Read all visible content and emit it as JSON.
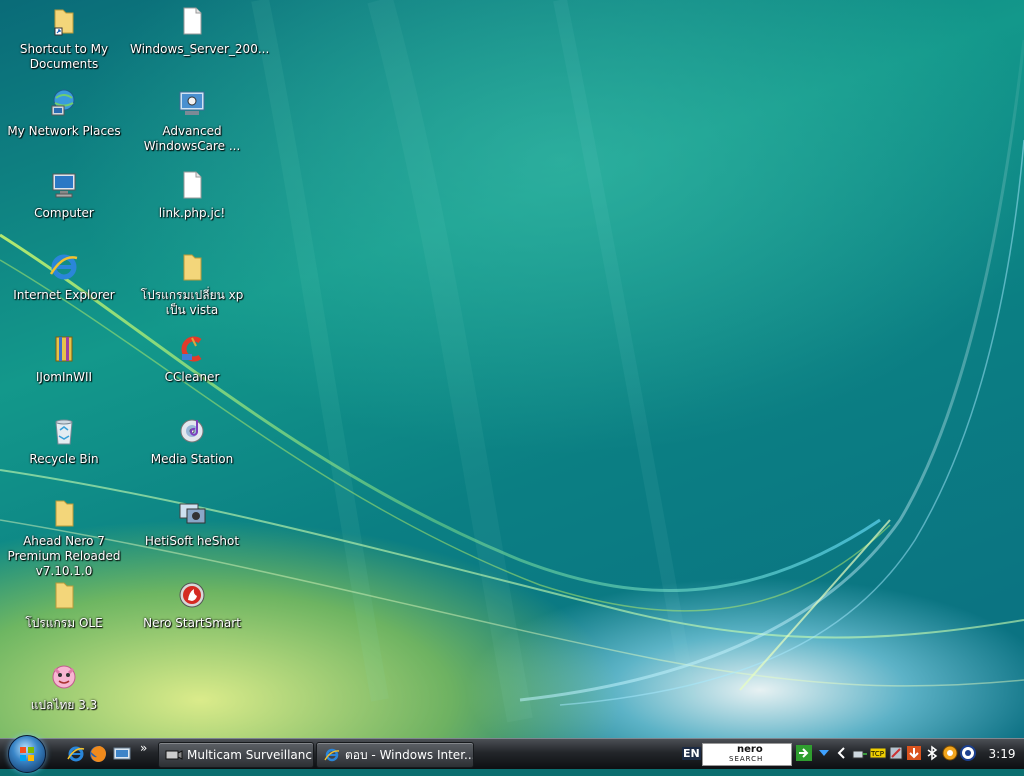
{
  "desktop": {
    "icons": [
      {
        "label": "Shortcut to My Documents",
        "icon": "folder-shortcut-icon"
      },
      {
        "label": "Windows_Server_200...",
        "icon": "document-icon"
      },
      {
        "label": "My Network Places",
        "icon": "network-places-icon"
      },
      {
        "label": "Advanced WindowsCare ...",
        "icon": "advanced-windowscare-icon"
      },
      {
        "label": "Computer",
        "icon": "computer-icon"
      },
      {
        "label": "link.php.jc!",
        "icon": "document-icon"
      },
      {
        "label": "Internet Explorer",
        "icon": "internet-explorer-icon"
      },
      {
        "label": "โปรแกรมเปลี่ยน xp เป็น vista",
        "icon": "folder-icon"
      },
      {
        "label": "IJomInWII",
        "icon": "winrar-archive-icon"
      },
      {
        "label": "CCleaner",
        "icon": "ccleaner-icon"
      },
      {
        "label": "Recycle Bin",
        "icon": "recycle-bin-icon"
      },
      {
        "label": "Media Station",
        "icon": "media-station-icon"
      },
      {
        "label": "Ahead Nero 7 Premium Reloaded v7.10.1.0",
        "icon": "folder-icon"
      },
      {
        "label": "HetiSoft heShot",
        "icon": "screenshot-app-icon"
      },
      {
        "label": "โปรแกรม OLE",
        "icon": "folder-icon"
      },
      {
        "label": "Nero StartSmart",
        "icon": "nero-startsmart-icon"
      },
      {
        "label": "แปลไทย 3.3",
        "icon": "translator-mascot-icon"
      }
    ]
  },
  "taskbar": {
    "start_icon": "windows-start-orb-icon",
    "quick_launch": [
      "internet-explorer-icon",
      "firefox-icon",
      "show-desktop-icon"
    ],
    "overflow_label": "»",
    "buttons": [
      {
        "label": "Multicam Surveillanc...",
        "icon": "camera-app-icon"
      },
      {
        "label": "ตอบ - Windows Inter...",
        "icon": "internet-explorer-icon"
      }
    ],
    "language": "EN",
    "nero_search": {
      "line1": "nero",
      "line2": "SEARCH"
    },
    "tray_icons": [
      "green-arrow-icon",
      "network-down-arrow-icon",
      "tray-expand-icon",
      "safely-remove-icon",
      "tcp-icon",
      "settings-icon",
      "download-icon",
      "bluetooth-icon",
      "app-orange-icon",
      "antivirus-icon"
    ],
    "clock": "3:19"
  },
  "colors": {
    "taskbar": "#1a1d21",
    "desktop_accent": "#0b7f83"
  }
}
